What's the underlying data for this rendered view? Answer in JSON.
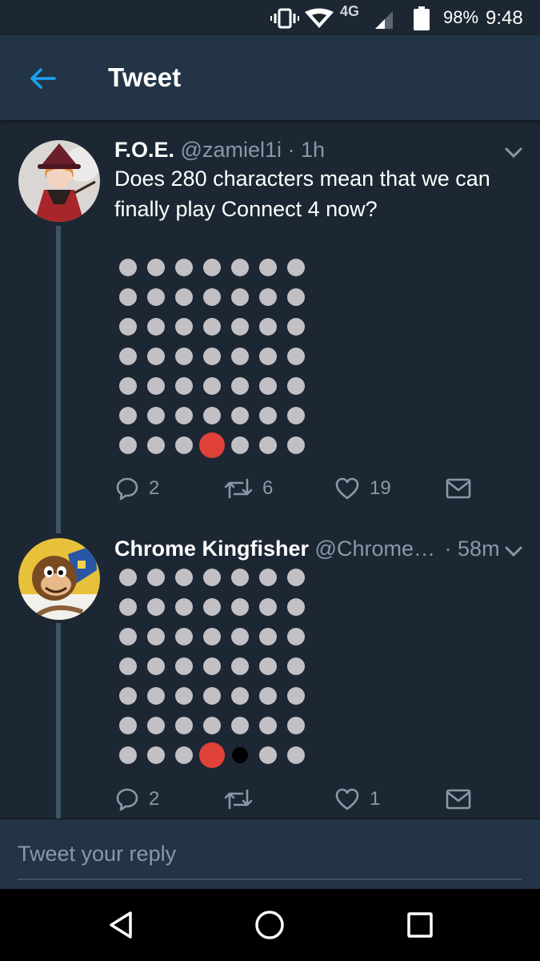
{
  "status_bar": {
    "network": "4G",
    "battery": "98%",
    "time": "9:48",
    "icons": [
      "vibrate-icon",
      "wifi-icon",
      "signal-icon",
      "battery-icon"
    ]
  },
  "header": {
    "title": "Tweet",
    "back_icon": "arrow-left-icon"
  },
  "colors": {
    "background": "#1c2733",
    "app_bar": "#243447",
    "accent": "#1da1f2",
    "muted": "#8899a6",
    "piece_red": "#e0423a",
    "piece_black": "#000000",
    "empty_slot": "#c2c0c4"
  },
  "tweets": [
    {
      "name": "F.O.E.",
      "handle": "@zamiel1i",
      "time": "1h",
      "text": "Does 280 characters mean that we can finally play Connect 4 now?",
      "board": {
        "columns": 7,
        "rows": 7,
        "pieces": [
          {
            "row": 7,
            "column": 4,
            "color": "red"
          }
        ]
      },
      "actions": {
        "replies": "2",
        "retweets": "6",
        "likes": "19"
      }
    },
    {
      "name": "Chrome Kingfisher",
      "handle": "@Chrome…",
      "time": "58m",
      "text": "",
      "board": {
        "columns": 7,
        "rows": 7,
        "pieces": [
          {
            "row": 7,
            "column": 4,
            "color": "red"
          },
          {
            "row": 7,
            "column": 5,
            "color": "black"
          }
        ]
      },
      "actions": {
        "replies": "2",
        "retweets": "",
        "likes": "1"
      }
    }
  ],
  "reply": {
    "placeholder": "Tweet your reply"
  },
  "nav": {
    "buttons": [
      "back-triangle-icon",
      "home-circle-icon",
      "recents-square-icon"
    ]
  }
}
